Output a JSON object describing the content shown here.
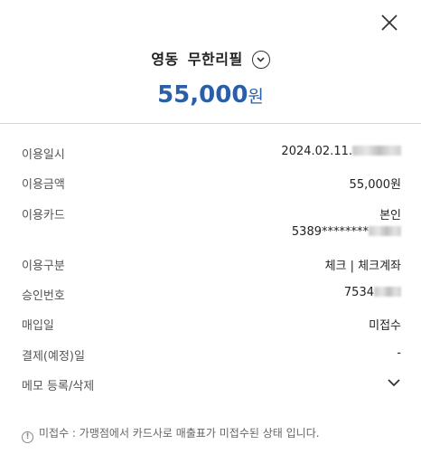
{
  "merchant": {
    "name_part1": "영동",
    "name_part2": "무한리필"
  },
  "amount": {
    "number": "55,000",
    "unit": "원"
  },
  "details": [
    {
      "label": "이용일시",
      "value": "2024.02.11."
    },
    {
      "label": "이용금액",
      "value": "55,000원"
    },
    {
      "label": "이용카드",
      "value": "본인",
      "value2": "5389********"
    },
    {
      "label": "이용구분",
      "value": "체크 | 체크계좌"
    },
    {
      "label": "승인번호",
      "value": "7534"
    },
    {
      "label": "매입일",
      "value": "미접수"
    },
    {
      "label": "결제(예정)일",
      "value": "-"
    },
    {
      "label": "메모 등록/삭제"
    }
  ],
  "notice": {
    "text": "미접수 : 가맹점에서 카드사로 매출표가 미접수된 상태 입니다."
  },
  "icons": {
    "close": "close-icon",
    "expand": "chevron-down-circle-icon",
    "memo": "chevron-down-icon",
    "notice": "info-icon"
  },
  "colors": {
    "accent": "#2a5ea7",
    "text": "#222222",
    "muted": "#555555"
  }
}
